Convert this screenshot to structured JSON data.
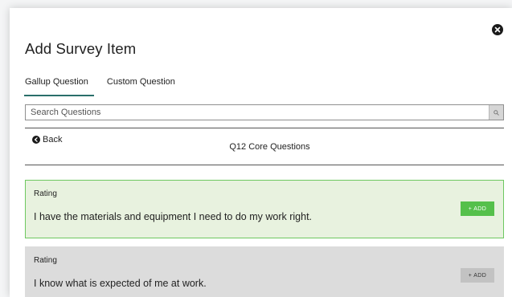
{
  "modal": {
    "title": "Add Survey Item"
  },
  "tabs": [
    {
      "label": "Gallup Question",
      "active": true
    },
    {
      "label": "Custom Question",
      "active": false
    }
  ],
  "search": {
    "value": "",
    "placeholder": "Search Questions"
  },
  "nav": {
    "back_label": "Back",
    "section_title": "Q12 Core Questions"
  },
  "questions": [
    {
      "type": "Rating",
      "text": "I have the materials and equipment I need to do my work right.",
      "add_label": "+ ADD",
      "highlighted": true
    },
    {
      "type": "Rating",
      "text": "I know what is expected of me at work.",
      "add_label": "+ ADD",
      "highlighted": false
    }
  ],
  "icons": {
    "close": "close-icon",
    "search": "search-icon",
    "back": "chevron-left-icon"
  },
  "colors": {
    "accent_tab": "#2a6f6a",
    "highlight_bg": "#e8f2df",
    "highlight_border": "#6ec860",
    "add_green": "#55c04b",
    "plain_bg": "#dcdcdc"
  }
}
